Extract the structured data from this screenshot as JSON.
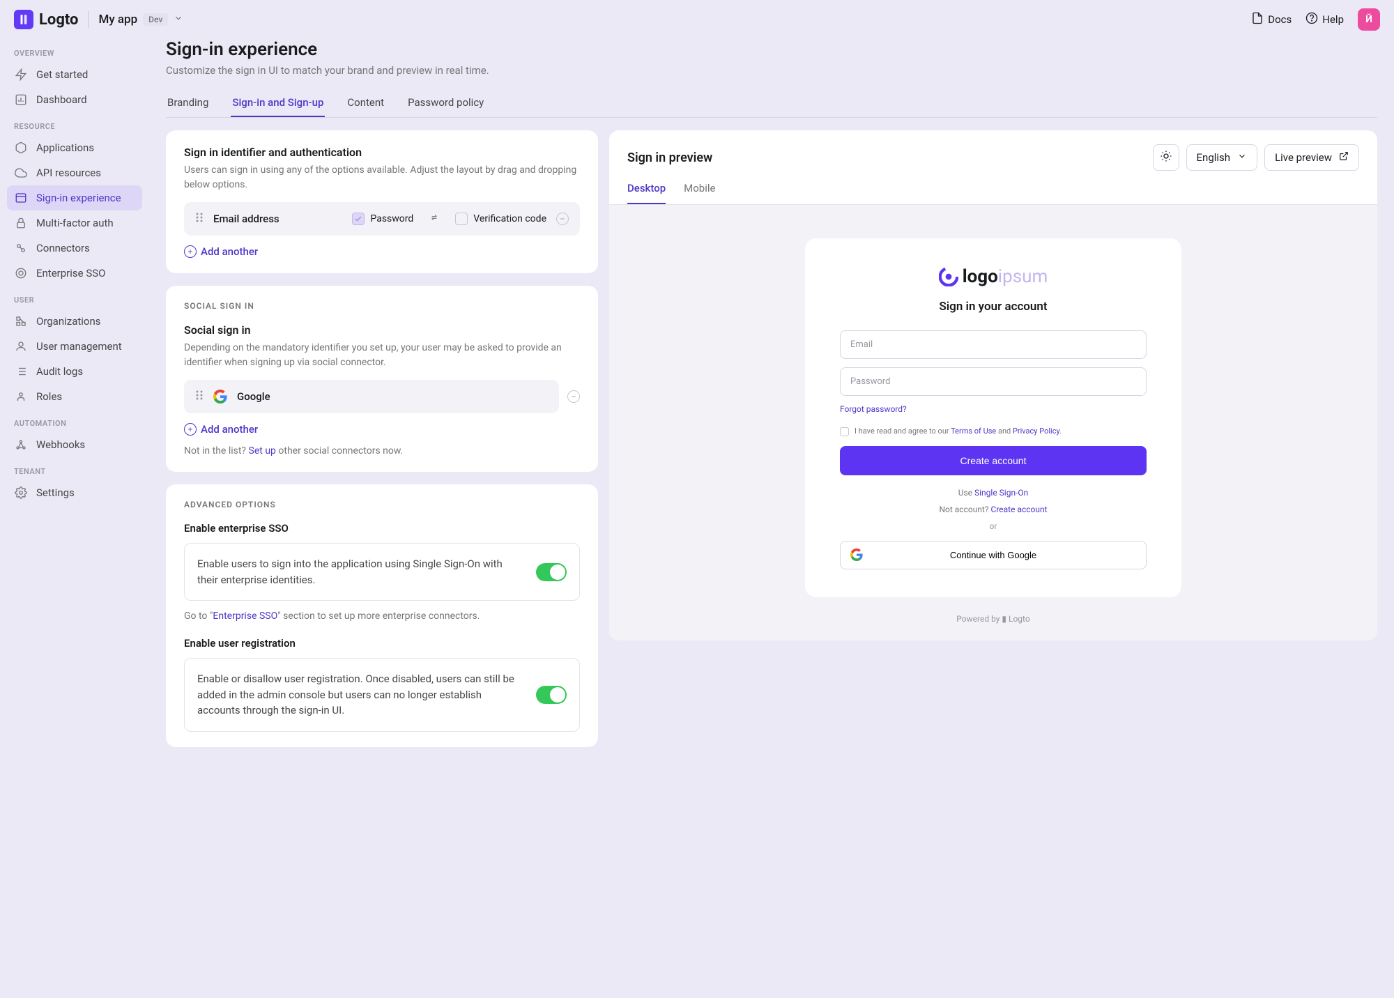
{
  "header": {
    "logo_text": "Logto",
    "app_name": "My app",
    "badge": "Dev",
    "docs": "Docs",
    "help": "Help",
    "avatar_letter": "Й"
  },
  "sidebar": {
    "overview": {
      "label": "OVERVIEW",
      "get_started": "Get started",
      "dashboard": "Dashboard"
    },
    "resource": {
      "label": "RESOURCE",
      "applications": "Applications",
      "api_resources": "API resources",
      "signin_exp": "Sign-in experience",
      "mfa": "Multi-factor auth",
      "connectors": "Connectors",
      "enterprise_sso": "Enterprise SSO"
    },
    "user": {
      "label": "USER",
      "organizations": "Organizations",
      "user_mgmt": "User management",
      "audit_logs": "Audit logs",
      "roles": "Roles"
    },
    "automation": {
      "label": "AUTOMATION",
      "webhooks": "Webhooks"
    },
    "tenant": {
      "label": "TENANT",
      "settings": "Settings"
    }
  },
  "page": {
    "title": "Sign-in experience",
    "subtitle": "Customize the sign in UI to match your brand and preview in real time."
  },
  "tabs": {
    "branding": "Branding",
    "signin_signup": "Sign-in and Sign-up",
    "content": "Content",
    "password_policy": "Password policy"
  },
  "signin_card": {
    "title": "Sign in identifier and authentication",
    "desc": "Users can sign in using any of the options available. Adjust the layout by drag and dropping below options.",
    "identifier": "Email address",
    "password": "Password",
    "verification": "Verification code",
    "add_another": "Add another"
  },
  "social_card": {
    "section_label": "SOCIAL SIGN IN",
    "title": "Social sign in",
    "desc": "Depending on the mandatory identifier you set up, your user may be asked to provide an identifier when signing up via social connector.",
    "google": "Google",
    "add_another": "Add another",
    "hint_prefix": "Not in the list? ",
    "hint_link": "Set up",
    "hint_suffix": " other social connectors now."
  },
  "advanced": {
    "section_label": "ADVANCED OPTIONS",
    "sso_title": "Enable enterprise SSO",
    "sso_desc": "Enable users to sign into the application using Single Sign-On with their enterprise identities.",
    "sso_hint_prefix": "Go to \"",
    "sso_hint_link": "Enterprise SSO",
    "sso_hint_suffix": "\" section to set up more enterprise connectors.",
    "reg_title": "Enable user registration",
    "reg_desc": "Enable or disallow user registration. Once disabled, users can still be added in the admin console but users can no longer establish accounts through the sign-in UI."
  },
  "preview": {
    "title": "Sign in preview",
    "language": "English",
    "live_preview": "Live preview",
    "tab_desktop": "Desktop",
    "tab_mobile": "Mobile",
    "logo_strong": "logo",
    "logo_light": "ipsum",
    "heading": "Sign in your account",
    "email_ph": "Email",
    "password_ph": "Password",
    "forgot": "Forgot password?",
    "terms_prefix": "I have read and agree to our ",
    "terms_tou": "Terms of Use",
    "terms_and": " and ",
    "terms_pp": "Privacy Policy",
    "create_btn": "Create account",
    "use_sso_prefix": "Use ",
    "use_sso_link": "Single Sign-On",
    "no_account_prefix": "Not account? ",
    "no_account_link": "Create account",
    "or": "or",
    "continue_google": "Continue with Google",
    "powered_prefix": "Powered by ",
    "powered_brand": "Logto"
  }
}
